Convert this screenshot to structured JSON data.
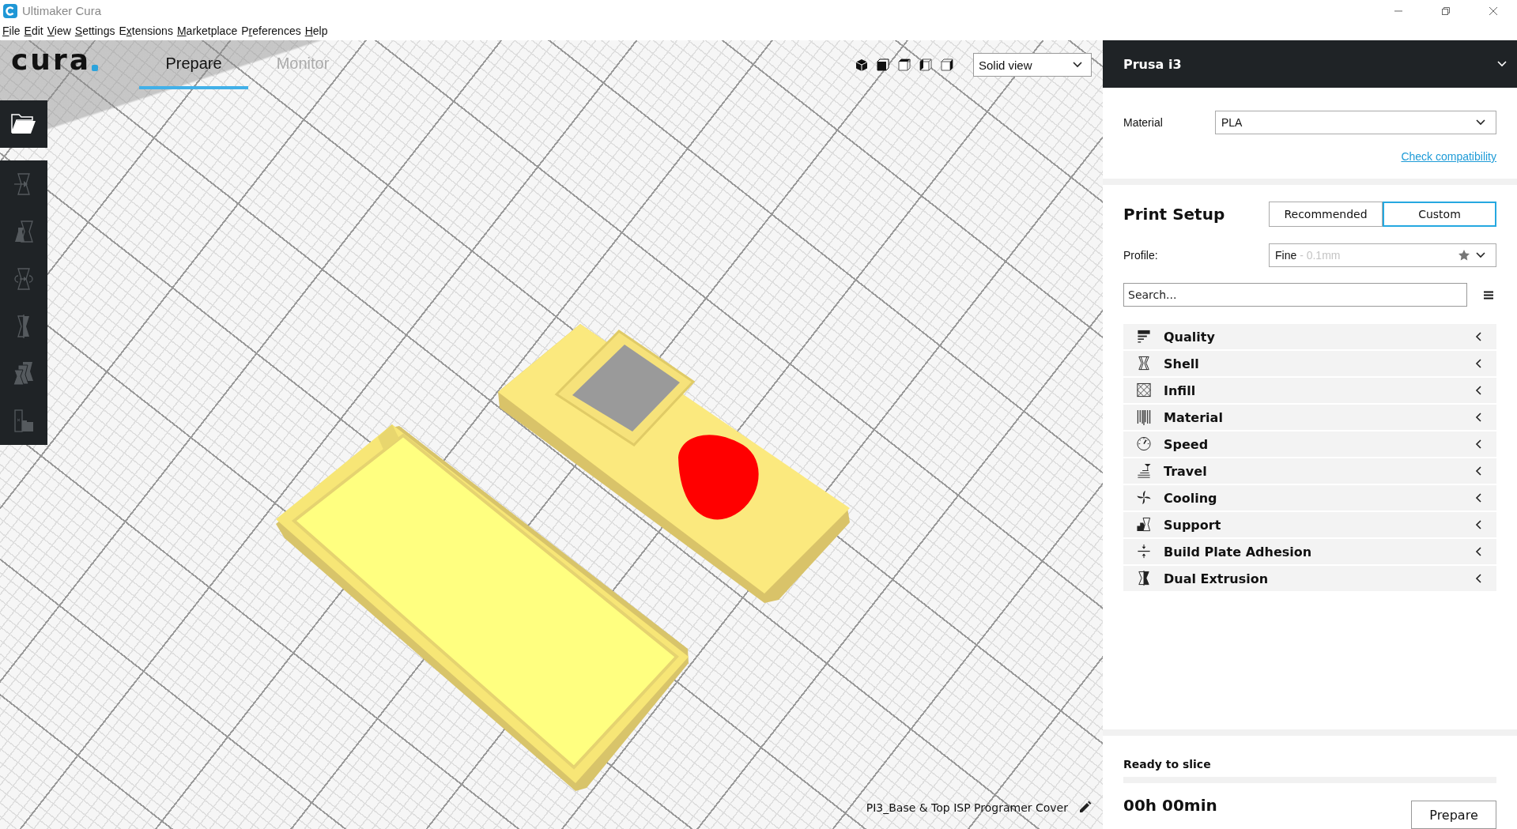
{
  "window": {
    "title": "Ultimaker Cura"
  },
  "menu": [
    {
      "key": "F",
      "post": "ile"
    },
    {
      "key": "E",
      "post": "dit"
    },
    {
      "key": "V",
      "post": "iew"
    },
    {
      "key": "S",
      "post": "ettings"
    },
    {
      "pre": "E",
      "key": "x",
      "post": "tensions"
    },
    {
      "key": "M",
      "post": "arketplace"
    },
    {
      "pre": "P",
      "key": "r",
      "post": "eferences"
    },
    {
      "key": "H",
      "post": "elp"
    }
  ],
  "header": {
    "logo": "cura",
    "tabs": [
      {
        "label": "Prepare",
        "selected": true
      },
      {
        "label": "Monitor",
        "selected": false
      }
    ],
    "view_mode": {
      "value": "Solid view"
    }
  },
  "tools": [
    {
      "kind": "move",
      "disabled": true
    },
    {
      "kind": "scale",
      "disabled": true
    },
    {
      "kind": "rotate",
      "disabled": true
    },
    {
      "kind": "mirror",
      "disabled": true
    },
    {
      "kind": "per_model",
      "disabled": true
    },
    {
      "kind": "support_blocker",
      "disabled": true
    }
  ],
  "object_name": "PI3_Base & Top ISP Programer Cover",
  "printer": {
    "name": "Prusa i3"
  },
  "material": {
    "label": "Material",
    "value": "PLA",
    "link": "Check compatibility"
  },
  "print_setup": {
    "title": "Print Setup",
    "modes": [
      {
        "label": "Recommended",
        "selected": false
      },
      {
        "label": "Custom",
        "selected": true
      }
    ],
    "profile_label": "Profile:",
    "profile": {
      "value": "Fine",
      "detail": "- 0.1mm"
    },
    "search": {
      "placeholder": "Search..."
    },
    "categories": [
      {
        "kind": "quality",
        "label": "Quality",
        "expanded": false
      },
      {
        "kind": "shell",
        "label": "Shell",
        "expanded": false
      },
      {
        "kind": "infill",
        "label": "Infill",
        "expanded": false
      },
      {
        "kind": "material",
        "label": "Material",
        "expanded": false
      },
      {
        "kind": "speed",
        "label": "Speed",
        "expanded": false
      },
      {
        "kind": "travel",
        "label": "Travel",
        "expanded": false
      },
      {
        "kind": "cooling",
        "label": "Cooling",
        "expanded": false
      },
      {
        "kind": "support",
        "label": "Support",
        "expanded": false
      },
      {
        "kind": "adhesion",
        "label": "Build Plate Adhesion",
        "expanded": false
      },
      {
        "kind": "dual",
        "label": "Dual Extrusion",
        "expanded": false
      }
    ]
  },
  "status": {
    "title": "Ready to slice",
    "time": "00h 00min",
    "button": "Prepare"
  }
}
